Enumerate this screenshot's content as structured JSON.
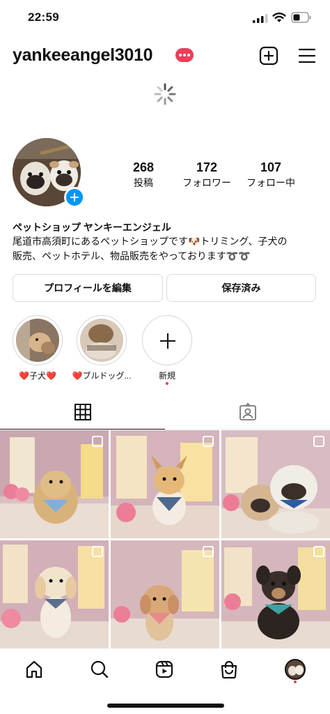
{
  "status_bar": {
    "time": "22:59"
  },
  "header": {
    "username": "yankeeangel3010",
    "icons": {
      "badge": "more-dots-badge",
      "create": "plus-square-icon",
      "menu": "hamburger-icon"
    }
  },
  "profile": {
    "stats": [
      {
        "value": "268",
        "label": "投稿"
      },
      {
        "value": "172",
        "label": "フォロワー"
      },
      {
        "value": "107",
        "label": "フォロー中"
      }
    ],
    "display_name": "ペットショップ ヤンキーエンジェル",
    "bio_line1": "尾道市高須町にあるペットショップです🐶トリミング、子犬の",
    "bio_line2": "販売、ペットホテル、物品販売をやっております➰➰"
  },
  "buttons": {
    "edit_profile": "プロフィールを編集",
    "saved": "保存済み"
  },
  "highlights": [
    {
      "label": "❤️子犬❤️"
    },
    {
      "label": "❤️ブルドッグ..."
    },
    {
      "label": "新規"
    }
  ],
  "colors": {
    "accent": "#0095f6",
    "notification": "#ee3e5a",
    "border": "#dbdbdb"
  },
  "nav": {
    "items": [
      "home-icon",
      "search-icon",
      "reels-icon",
      "shop-icon",
      "profile-avatar"
    ]
  }
}
